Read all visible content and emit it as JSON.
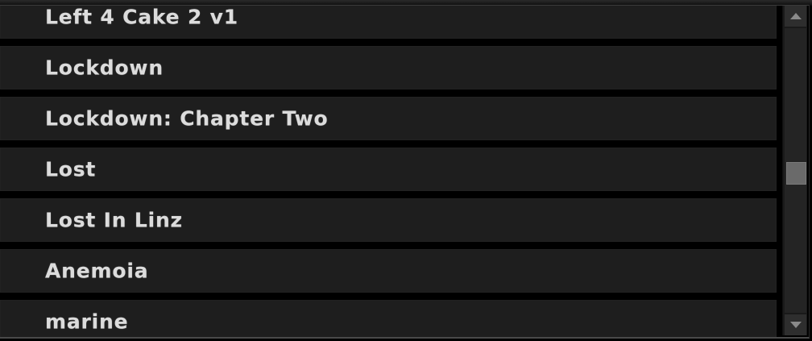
{
  "list": {
    "items": [
      {
        "label": "Left 4 Cake 2 v1"
      },
      {
        "label": "Lockdown"
      },
      {
        "label": "Lockdown: Chapter Two"
      },
      {
        "label": "Lost"
      },
      {
        "label": "Lost In Linz"
      },
      {
        "label": "Anemoia"
      },
      {
        "label": "marine"
      }
    ]
  },
  "scrollbar": {
    "up_icon": "triangle-up-icon",
    "down_icon": "triangle-down-icon"
  }
}
